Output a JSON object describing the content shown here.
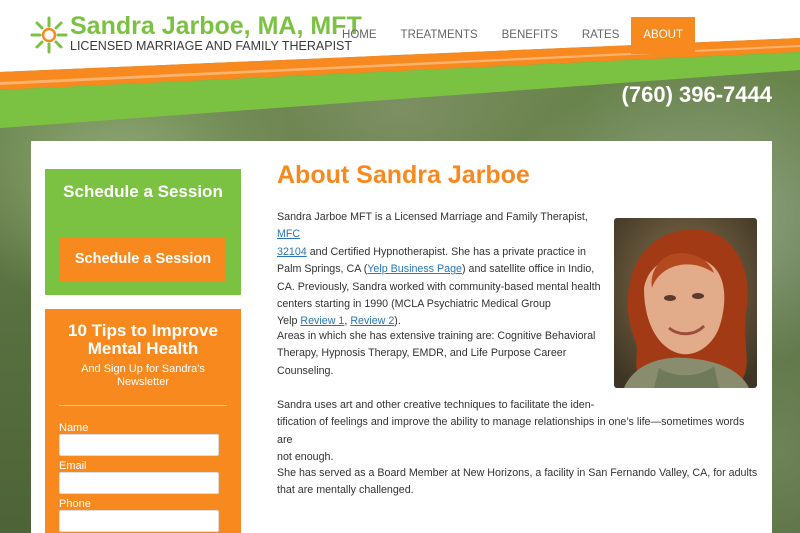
{
  "site": {
    "name": "Sandra Jarboe, MA, MFT",
    "tagline": "LICENSED MARRIAGE AND FAMILY THERAPIST",
    "phone": "(760) 396-7444"
  },
  "nav": [
    {
      "label": "HOME"
    },
    {
      "label": "TREATMENTS"
    },
    {
      "label": "BENEFITS"
    },
    {
      "label": "RATES"
    },
    {
      "label": "ABOUT",
      "active": true
    }
  ],
  "sidebar": {
    "schedule": {
      "title": "Schedule a Session",
      "button_label": "Schedule a Session"
    },
    "tips": {
      "title_line1": "10 Tips to Improve",
      "title_line2": "Mental Health",
      "subtitle_line1": "And Sign Up for Sandra's",
      "subtitle_line2": "Newsletter",
      "fields": [
        {
          "label": "Name",
          "value": ""
        },
        {
          "label": "Email",
          "value": ""
        },
        {
          "label": "Phone",
          "value": ""
        }
      ]
    }
  },
  "main": {
    "title": "About Sandra Jarboe",
    "p1": {
      "l1a": "Sandra Jarboe MFT is a Licensed Marriage and Family Therapist, ",
      "l1link": "MFC",
      "l2link": "32104",
      "l2b": " and Certified Hypnotherapist.  She has a private practice in",
      "l3a": "Palm Springs, CA (",
      "l3link": "Yelp Business Page",
      "l3b": ") and satellite office in Indio,",
      "l4": "CA.  Previously, Sandra worked with community-based mental health",
      "l5": "centers starting in 1990 (MCLA Psychiatric Medical Group",
      "l6a": "Yelp ",
      "l6link1": "Review 1",
      "l6sep": ", ",
      "l6link2": "Review 2",
      "l6b": ")."
    },
    "p2": {
      "l1": "Areas in which she has extensive training are: Cognitive Behavioral",
      "l2": "Therapy, Hypnosis Therapy, EMDR, and Life Purpose Career",
      "l3": "Counseling."
    },
    "p3": {
      "l1": "Sandra uses art and other creative techniques to facilitate the   iden-",
      "l2": "tification of feelings and improve the ability to manage relationships in one’s life—sometimes words are",
      "l3": "not enough."
    },
    "p4": {
      "l1": "She has served as a Board Member at New Horizons, a facility in San Fernando Valley, CA, for adults",
      "l2": "that are mentally challenged."
    }
  },
  "colors": {
    "orange": "#f7891f",
    "green": "#7cc242",
    "link": "#2a76b6"
  },
  "icons": [
    "sun-logo-icon"
  ]
}
